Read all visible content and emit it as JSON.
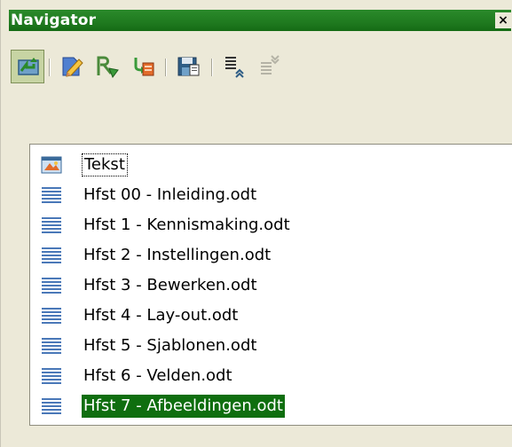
{
  "window": {
    "title": "Navigator",
    "close_glyph": "×"
  },
  "toolbar": {
    "buttons": [
      {
        "name": "toggle-icon",
        "active": true
      },
      {
        "name": "content-view-icon",
        "active": false
      },
      {
        "name": "navigation-icon",
        "active": false
      },
      {
        "name": "edit-icon",
        "active": false
      },
      {
        "name": "save-as-icon",
        "active": false
      },
      {
        "name": "promote-level-icon",
        "active": false
      },
      {
        "name": "demote-level-icon",
        "active": false
      }
    ]
  },
  "tree": {
    "root": {
      "label": "Tekst",
      "icon": "text-document-icon"
    },
    "items": [
      {
        "label": "Hfst 00 - Inleiding.odt",
        "icon": "subdocument-icon"
      },
      {
        "label": "Hfst 1 - Kennismaking.odt",
        "icon": "subdocument-icon"
      },
      {
        "label": "Hfst 2 - Instellingen.odt",
        "icon": "subdocument-icon"
      },
      {
        "label": "Hfst 3 - Bewerken.odt",
        "icon": "subdocument-icon"
      },
      {
        "label": "Hfst 4 - Lay-out.odt",
        "icon": "subdocument-icon"
      },
      {
        "label": "Hfst 5 - Sjablonen.odt",
        "icon": "subdocument-icon"
      },
      {
        "label": "Hfst 6 - Velden.odt",
        "icon": "subdocument-icon"
      },
      {
        "label": "Hfst 7 - Afbeeldingen.odt",
        "icon": "subdocument-icon",
        "selected": true
      }
    ]
  },
  "colors": {
    "titlebar": "#1f7a1f",
    "selection": "#0f6e0f",
    "panel": "#ece9d8"
  }
}
